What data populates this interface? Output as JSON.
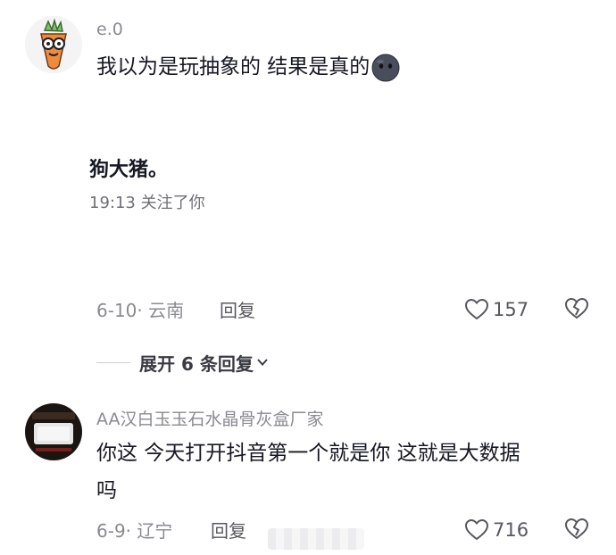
{
  "comments": [
    {
      "username": "e.0",
      "text": "我以为是玩抽象的 结果是真的",
      "emoji": "dark-face-emoji",
      "image_caption": "狗大猪。",
      "image_meta": "19:13  关注了你",
      "date_location": "6-10· 云南",
      "reply_label": "回复",
      "likes": "157"
    },
    {
      "username": "AA汉白玉玉石水晶骨灰盒厂家",
      "text_line1": "你这 今天打开抖音第一个就是你 这就是大数据",
      "text_line2": "吗",
      "date_location": "6-9· 辽宁",
      "reply_label": "回复",
      "likes": "716"
    }
  ],
  "expand_replies_label": "展开 6 条回复",
  "colors": {
    "text_primary": "#161823",
    "text_secondary": "#8a8b91",
    "avatar_carrot": "#f08a3c",
    "avatar_leaf": "#7cc36a"
  }
}
